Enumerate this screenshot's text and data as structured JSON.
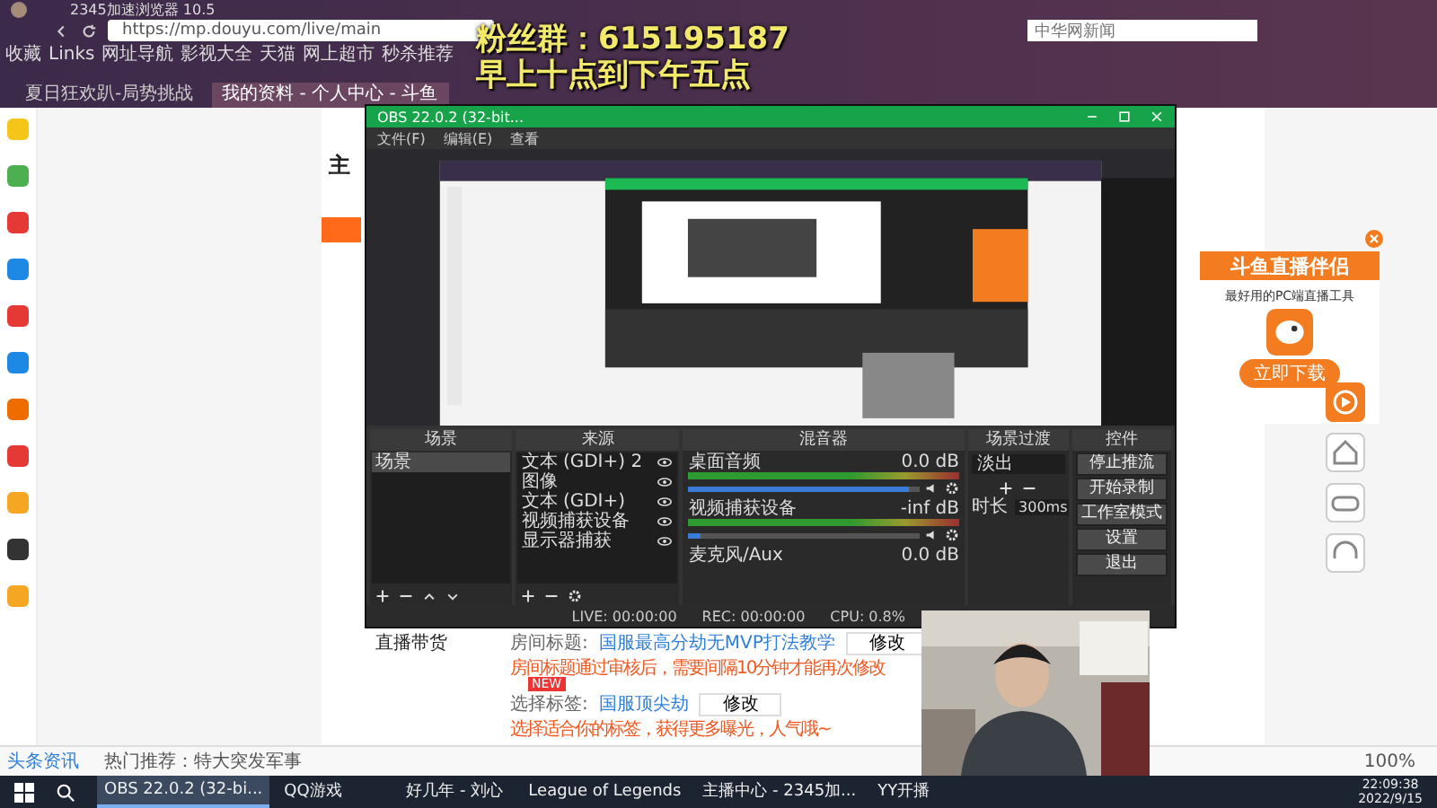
{
  "browser": {
    "title": "2345加速浏览器 10.5",
    "url": "https://mp.douyu.com/live/main",
    "search": {
      "placeholder": "中华网新闻"
    },
    "bookmarks": [
      "收藏",
      "Links",
      "网址导航",
      "影视大全",
      "天猫",
      "网上超市",
      "秒杀推荐"
    ],
    "tabs": [
      {
        "label": "夏日狂欢趴-局势挑战",
        "selected": false
      },
      {
        "label": "我的资料 - 个人中心 - 斗鱼",
        "selected": true
      }
    ],
    "app_icons": [
      {
        "color": "#f5c518"
      },
      {
        "color": "#4caf50"
      },
      {
        "color": "#e53935"
      },
      {
        "color": "#1e88e5"
      },
      {
        "color": "#e53935"
      },
      {
        "color": "#1e88e5"
      },
      {
        "color": "#ef6c00"
      },
      {
        "color": "#e53935"
      },
      {
        "color": "#f5a623"
      },
      {
        "color": "#333333"
      },
      {
        "color": "#f5a623"
      }
    ],
    "status_bar": {
      "news": "头条资讯",
      "hot": "热门推荐：特大突发军事",
      "zoom": "100%"
    }
  },
  "page": {
    "sidebar_heading": "主",
    "sidebar_item": "直播带货",
    "form": [
      {
        "label": "房间标题:",
        "value": "国服最高分劫无MVP打法教学",
        "button": "修改",
        "hint": "房间标题通过审核后，需要间隔10分钟才能再次修改"
      },
      {
        "label": "选择标签:",
        "badge": "NEW",
        "value": "国服顶尖劫",
        "button": "修改",
        "hint": "选择适合你的标签，获得更多曝光，人气哦~"
      }
    ],
    "ad": {
      "title": "斗鱼直播伴侣",
      "subtitle": "最好用的PC端直播工具",
      "button": "立即下载"
    }
  },
  "overlay": [
    "粉丝群：615195187",
    "早上十点到下午五点"
  ],
  "obs": {
    "title": "OBS 22.0.2 (32-bit...",
    "menu": [
      "文件(F)",
      "编辑(E)",
      "查看"
    ],
    "scenes": {
      "header": "场景",
      "items": [
        {
          "label": "场景",
          "selected": true
        }
      ]
    },
    "sources": {
      "header": "来源",
      "items": [
        "文本 (GDI+) 2",
        "图像",
        "文本 (GDI+)",
        "视频捕获设备",
        "显示器捕获"
      ]
    },
    "mixer": {
      "header": "混音器",
      "channels": [
        {
          "name": "桌面音频",
          "reading": "0.0 dB",
          "level": 0.95
        },
        {
          "name": "视频捕获设备",
          "reading": "-inf dB",
          "level": 0.05
        },
        {
          "name": "麦克风/Aux",
          "reading": "0.0 dB"
        }
      ]
    },
    "transitions": {
      "header": "场景过渡",
      "type": "淡出",
      "duration_label": "时长",
      "duration": "300ms"
    },
    "controls": {
      "header": "控件",
      "buttons": [
        "停止推流",
        "开始录制",
        "工作室模式",
        "设置",
        "退出"
      ]
    },
    "status": [
      "LIVE: 00:00:00",
      "REC: 00:00:00",
      "CPU: 0.8%"
    ]
  },
  "taskbar": {
    "items": [
      {
        "label": "OBS 22.0.2 (32-bi...",
        "selected": true
      },
      {
        "label": "QQ游戏",
        "selected": false
      },
      {
        "label": "好几年 - 刘心",
        "selected": false
      },
      {
        "label": "League of Legends",
        "selected": false
      },
      {
        "label": "主播中心 - 2345加...",
        "selected": false
      },
      {
        "label": "YY开播",
        "selected": false
      }
    ],
    "time": "22:09:38",
    "date": "2022/9/15"
  }
}
